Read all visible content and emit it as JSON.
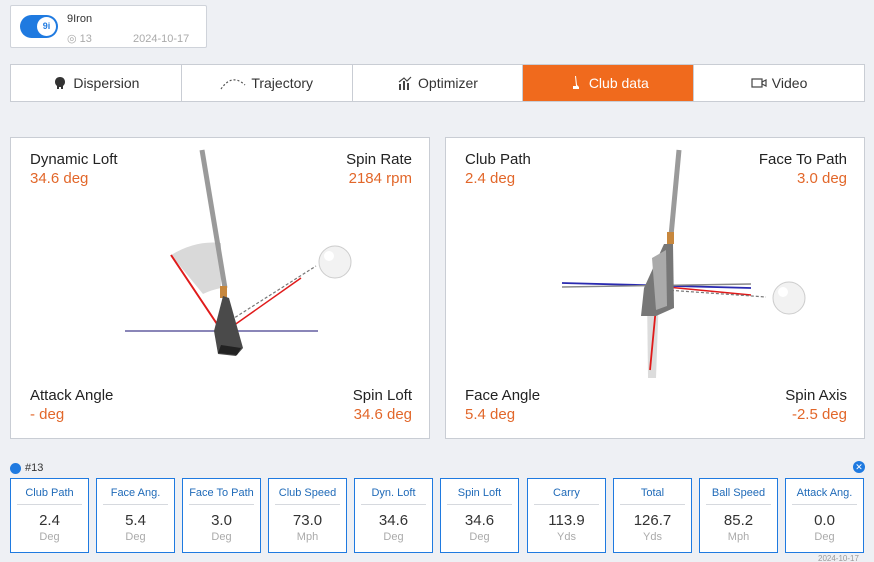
{
  "club": {
    "badge": "9i",
    "name": "9Iron",
    "count": "13",
    "date": "2024-10-17"
  },
  "tabs": [
    {
      "label": "Dispersion",
      "icon": "dispersion-icon",
      "active": false
    },
    {
      "label": "Trajectory",
      "icon": "trajectory-icon",
      "active": false
    },
    {
      "label": "Optimizer",
      "icon": "optimizer-icon",
      "active": false
    },
    {
      "label": "Club data",
      "icon": "club-data-icon",
      "active": true
    },
    {
      "label": "Video",
      "icon": "video-icon",
      "active": false
    }
  ],
  "left_panel": {
    "top_left": {
      "label": "Dynamic Loft",
      "value": "34.6 deg"
    },
    "top_right": {
      "label": "Spin Rate",
      "value": "2184 rpm"
    },
    "bottom_left": {
      "label": "Attack Angle",
      "value": "- deg"
    },
    "bottom_right": {
      "label": "Spin Loft",
      "value": "34.6 deg"
    }
  },
  "right_panel": {
    "top_left": {
      "label": "Club Path",
      "value": "2.4 deg"
    },
    "top_right": {
      "label": "Face To Path",
      "value": "3.0 deg"
    },
    "bottom_left": {
      "label": "Face Angle",
      "value": "5.4 deg"
    },
    "bottom_right": {
      "label": "Spin Axis",
      "value": "-2.5 deg"
    }
  },
  "shot": {
    "label": "#13",
    "date": "2024-10-17",
    "stats": [
      {
        "title": "Club Path",
        "value": "2.4",
        "unit": "Deg"
      },
      {
        "title": "Face Ang.",
        "value": "5.4",
        "unit": "Deg"
      },
      {
        "title": "Face To Path",
        "value": "3.0",
        "unit": "Deg"
      },
      {
        "title": "Club Speed",
        "value": "73.0",
        "unit": "Mph"
      },
      {
        "title": "Dyn. Loft",
        "value": "34.6",
        "unit": "Deg"
      },
      {
        "title": "Spin Loft",
        "value": "34.6",
        "unit": "Deg"
      },
      {
        "title": "Carry",
        "value": "113.9",
        "unit": "Yds"
      },
      {
        "title": "Total",
        "value": "126.7",
        "unit": "Yds"
      },
      {
        "title": "Ball Speed",
        "value": "85.2",
        "unit": "Mph"
      },
      {
        "title": "Attack Ang.",
        "value": "0.0",
        "unit": "Deg"
      }
    ]
  },
  "colors": {
    "accent": "#f06a1d",
    "value": "#e2672a",
    "blue": "#1f7ae0"
  }
}
